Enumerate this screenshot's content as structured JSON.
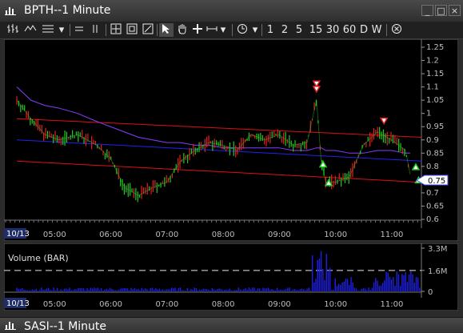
{
  "window": {
    "title": "BPTH--1 Minute"
  },
  "window_buttons": {
    "minimize": "_",
    "maximize": "□",
    "close": "×"
  },
  "toolbar": {
    "intervals": [
      "1",
      "2",
      "5",
      "15",
      "30",
      "60",
      "D",
      "W"
    ],
    "dropdown_glyph": "▾"
  },
  "icons": [
    "bar-chart-icon",
    "candlestick-icon",
    "line-style-icon",
    "hline-icon",
    "vline-icon",
    "crosshair-icon",
    "zoom-box-icon",
    "zoom-out-icon",
    "cursor-icon",
    "hand-icon",
    "plus-icon",
    "measure-icon",
    "clock-icon",
    "indicators-icon",
    "close-icon"
  ],
  "price_pane": {
    "date_label": "10/13",
    "time_labels": [
      "05:00",
      "06:00",
      "07:00",
      "08:00",
      "09:00",
      "10:00",
      "11:00"
    ],
    "price_ticks": [
      "1.25",
      "1.2",
      "1.15",
      "1.1",
      "1.05",
      "1",
      "0.95",
      "0.9",
      "0.85",
      "0.8",
      "0.75",
      "0.7",
      "0.65",
      "0.6"
    ],
    "current_price": "0.75"
  },
  "volume_pane": {
    "label": "Volume (BAR)",
    "ticks": [
      "3.3M",
      "1.6M",
      "0"
    ],
    "date_label": "10/13",
    "time_labels": [
      "05:00",
      "06:00",
      "07:00",
      "08:00",
      "09:00",
      "10:00",
      "11:00"
    ]
  },
  "chart_data": {
    "type": "line",
    "title": "BPTH--1 Minute",
    "x_labels": [
      "05:00",
      "06:00",
      "07:00",
      "08:00",
      "09:00",
      "10:00",
      "11:00"
    ],
    "ylim": [
      0.6,
      1.25
    ],
    "series": [
      {
        "color": "#2bd12b",
        "x": [
          "04:20",
          "04:35",
          "04:50",
          "05:05",
          "05:25",
          "05:45",
          "06:00",
          "06:15",
          "06:30",
          "06:45",
          "07:00",
          "07:15",
          "07:30",
          "07:45",
          "08:00",
          "08:15",
          "08:30",
          "08:45",
          "09:00",
          "09:15",
          "09:30",
          "09:40",
          "09:45",
          "09:50",
          "10:00",
          "10:15",
          "10:30",
          "10:45",
          "11:00",
          "11:15",
          "11:20"
        ],
        "values": [
          1.05,
          0.98,
          0.92,
          0.9,
          0.92,
          0.88,
          0.83,
          0.72,
          0.69,
          0.72,
          0.74,
          0.82,
          0.86,
          0.89,
          0.88,
          0.86,
          0.92,
          0.9,
          0.92,
          0.88,
          0.89,
          1.05,
          0.82,
          0.74,
          0.74,
          0.76,
          0.88,
          0.93,
          0.9,
          0.86,
          0.77
        ]
      },
      {
        "color": "#8a3bff",
        "values": [
          1.1,
          1.05,
          1.03,
          1.02,
          1.0,
          0.97,
          0.95,
          0.93,
          0.91,
          0.9,
          0.89,
          0.89,
          0.88,
          0.88,
          0.87,
          0.87,
          0.87,
          0.87,
          0.87,
          0.86,
          0.86,
          0.87,
          0.87,
          0.86,
          0.86,
          0.85,
          0.85,
          0.86,
          0.86,
          0.85,
          0.85
        ]
      },
      {
        "color": "#2222ee",
        "start": 0.9,
        "end": 0.82
      },
      {
        "color": "#dd1111",
        "start": 0.98,
        "end": 0.91
      },
      {
        "color": "#dd1111",
        "start": 0.82,
        "end": 0.74
      }
    ],
    "volume": {
      "ylim": [
        0,
        3.3
      ],
      "unit": "M",
      "dashed_level": 1.6
    }
  }
}
